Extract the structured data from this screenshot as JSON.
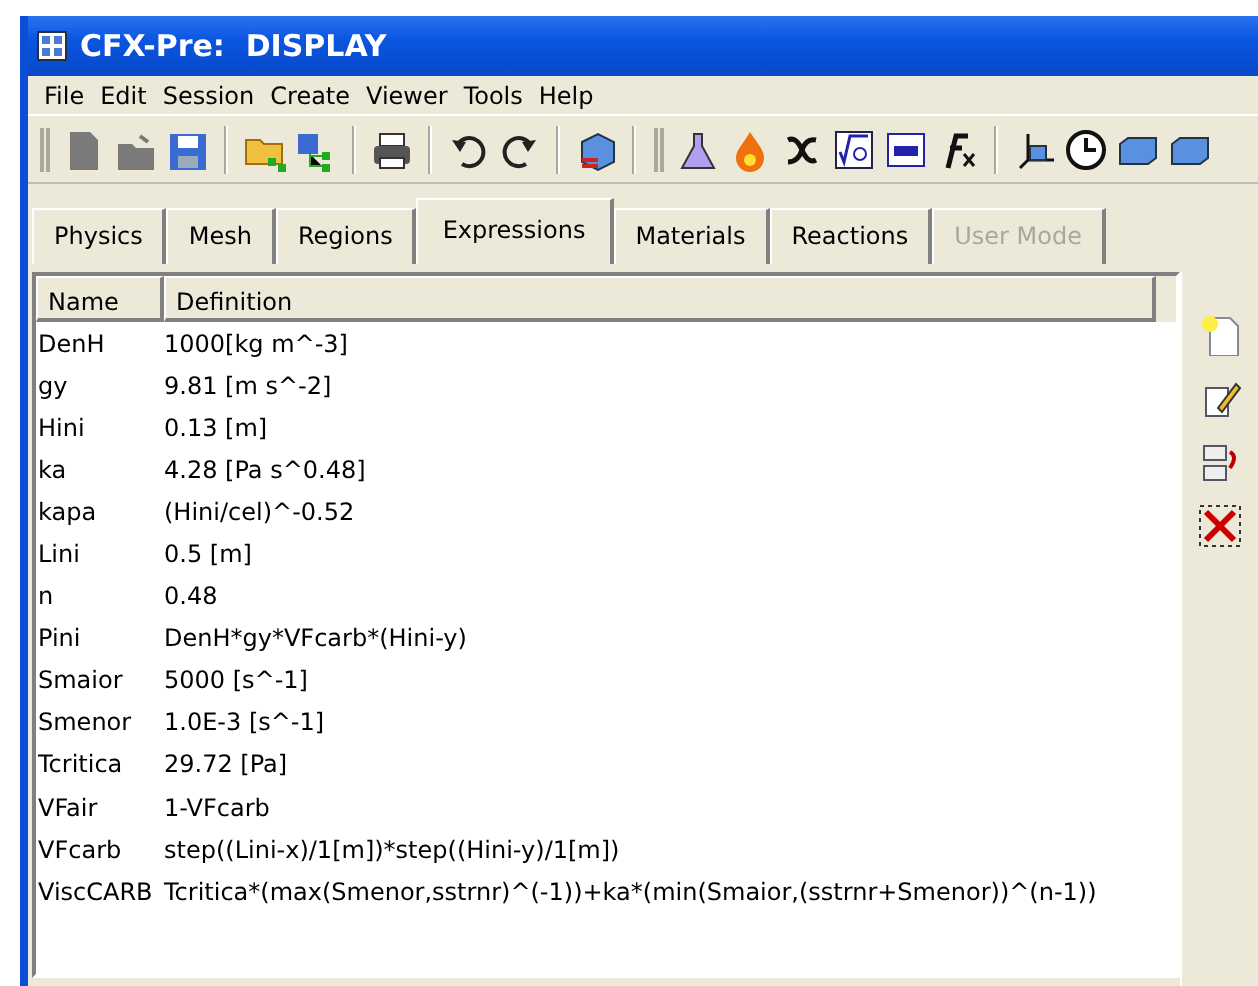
{
  "window": {
    "title": "CFX-Pre:  DISPLAY"
  },
  "menu": [
    "File",
    "Edit",
    "Session",
    "Create",
    "Viewer",
    "Tools",
    "Help"
  ],
  "tabs": [
    {
      "label": "Physics",
      "selected": false,
      "disabled": false
    },
    {
      "label": "Mesh",
      "selected": false,
      "disabled": false
    },
    {
      "label": "Regions",
      "selected": false,
      "disabled": false
    },
    {
      "label": "Expressions",
      "selected": true,
      "disabled": false
    },
    {
      "label": "Materials",
      "selected": false,
      "disabled": false
    },
    {
      "label": "Reactions",
      "selected": false,
      "disabled": false
    },
    {
      "label": "User Mode",
      "selected": false,
      "disabled": true
    }
  ],
  "table": {
    "columns": [
      "Name",
      "Definition"
    ],
    "rows": [
      [
        "DenH",
        "1000[kg m^-3]"
      ],
      [
        "gy",
        "9.81 [m s^-2]"
      ],
      [
        "Hini",
        "0.13 [m]"
      ],
      [
        "ka",
        "4.28 [Pa s^0.48]"
      ],
      [
        "kapa",
        "(Hini/cel)^-0.52"
      ],
      [
        "Lini",
        "0.5 [m]"
      ],
      [
        "n",
        "0.48"
      ],
      [
        "Pini",
        "DenH*gy*VFcarb*(Hini-y)"
      ],
      [
        "Smaior",
        "5000 [s^-1]"
      ],
      [
        "Smenor",
        "1.0E-3 [s^-1]"
      ],
      [
        "Tcritica",
        "29.72 [Pa]"
      ],
      [
        "VFair",
        "1-VFcarb"
      ],
      [
        "VFcarb",
        "step((Lini-x)/1[m])*step((Hini-y)/1[m])"
      ],
      [
        "ViscCARB",
        "Tcritica*(max(Smenor,sstrnr)^(-1))+ka*(min(Smaior,(sstrnr+Smenor))^(n-1))"
      ]
    ]
  }
}
